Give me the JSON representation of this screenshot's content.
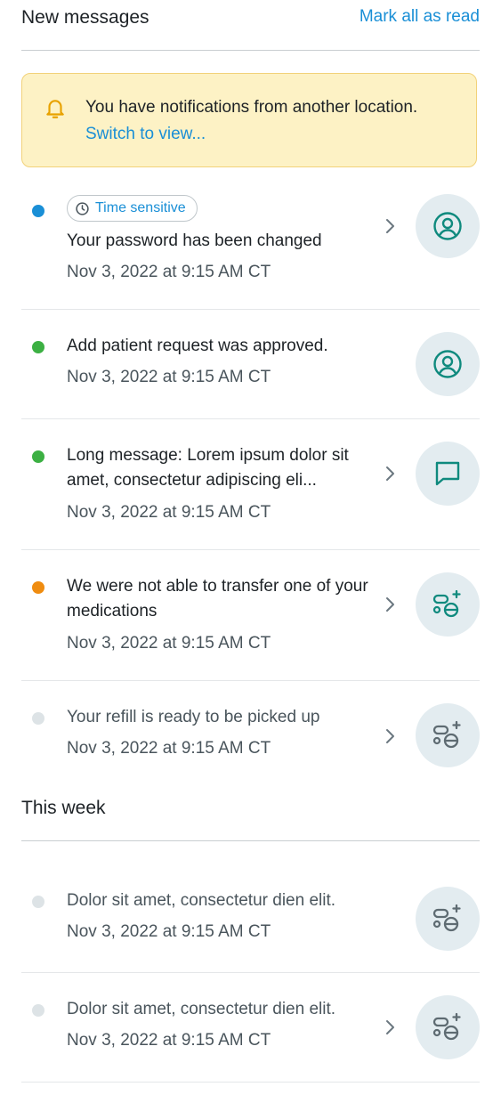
{
  "new_messages": {
    "title": "New messages",
    "mark_all": "Mark all as read"
  },
  "banner": {
    "message": "You have notifications from another location.",
    "link": "Switch to view..."
  },
  "notifications": [
    {
      "badge": "Time sensitive",
      "text": "Your password has been changed",
      "date": "Nov 3, 2022 at 9:15 AM CT",
      "dot_color": "#1a8fd6",
      "icon": "user-icon",
      "has_chevron": true
    },
    {
      "text": "Add patient request was approved.",
      "date": "Nov 3, 2022 at 9:15 AM CT",
      "dot_color": "#3cb043",
      "icon": "user-icon",
      "has_chevron": false
    },
    {
      "text": "Long message: Lorem ipsum dolor sit amet, consectetur adipiscing eli...",
      "date": "Nov 3, 2022 at 9:15 AM CT",
      "dot_color": "#3cb043",
      "icon": "message-icon",
      "has_chevron": true
    },
    {
      "text": "We were not able to transfer one of your medications",
      "date": "Nov 3, 2022 at 9:15 AM CT",
      "dot_color": "#ef8c10",
      "icon": "medication-icon",
      "has_chevron": true
    },
    {
      "text": "Your refill is ready to be picked up",
      "date": "Nov 3, 2022 at 9:15 AM CT",
      "dot_color": "#dde3e6",
      "icon": "medication-icon",
      "has_chevron": true
    }
  ],
  "this_week": {
    "title": "This week",
    "items": [
      {
        "text": "Dolor sit amet, consectetur dien elit.",
        "date": "Nov 3, 2022 at 9:15 AM CT",
        "dot_color": "#dde3e6",
        "icon": "medication-icon",
        "has_chevron": false
      },
      {
        "text": "Dolor sit amet, consectetur dien elit.",
        "date": "Nov 3, 2022 at 9:15 AM CT",
        "dot_color": "#dde3e6",
        "icon": "medication-icon",
        "has_chevron": true
      }
    ]
  },
  "colors": {
    "accent_blue": "#1a8fd6",
    "teal_icon": "#0f8a7e",
    "gray_icon": "#5e6b72",
    "banner_bg": "#fdf2c5",
    "banner_border": "#f2d27a"
  }
}
